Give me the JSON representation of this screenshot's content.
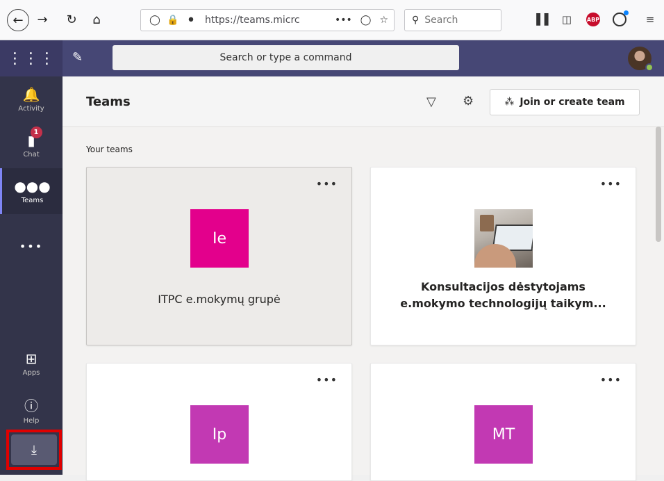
{
  "browser": {
    "back_icon": "back-arrow-icon",
    "forward_icon": "forward-arrow-icon",
    "url": "https://teams.micrc",
    "search_placeholder": "Search",
    "abp_label": "ABP"
  },
  "teams_header": {
    "search_placeholder": "Search or type a command"
  },
  "rail": {
    "activity": "Activity",
    "chat": "Chat",
    "chat_badge": "1",
    "teams": "Teams",
    "more": "•••",
    "apps": "Apps",
    "help": "Help"
  },
  "main": {
    "title": "Teams",
    "join_label": "Join or create team",
    "section_label": "Your teams"
  },
  "teams": [
    {
      "tile_text": "Ie",
      "name": "ITPC e.mokymų grupė",
      "tile_color": "#e3008c"
    },
    {
      "name_line1": "Konsultacijos dėstytojams",
      "name_line2": "e.mokymo technologijų taikym..."
    },
    {
      "tile_text": "Ip",
      "tile_color": "#c239b3"
    },
    {
      "tile_text": "MT",
      "tile_color": "#c239b3"
    }
  ],
  "more_label": "•••"
}
